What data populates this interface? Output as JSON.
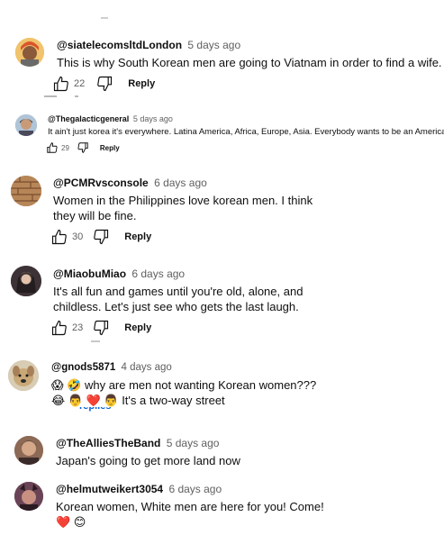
{
  "comments": [
    {
      "author": "@siatelecomsltdLondon",
      "time": "5 days ago",
      "text": "This is why South Korean men are going to Viatnam in order to find a wife.",
      "likes": "22",
      "reply": "Reply",
      "avatar_color": "#e8b65a"
    },
    {
      "author": "@Thegalacticgeneral",
      "time": "5 days ago",
      "text": "It ain't just korea it's everywhere. Latina America, Africa, Europe, Asia. Everybody wants to be an American.",
      "likes": "29",
      "reply": "Reply",
      "avatar_color": "#8a9bb0"
    },
    {
      "author": "@PCMRvsconsole",
      "time": "6 days ago",
      "text_line1": "Women in the Philippines love korean men. I think",
      "text_line2": "they will be fine.",
      "likes": "30",
      "reply": "Reply",
      "avatar_color": "#a87a52"
    },
    {
      "author": "@MiaobuMiao",
      "time": "6 days ago",
      "text_line1": "It's all fun and games until you're old, alone, and",
      "text_line2": "childless. Let's just see who gets the last laugh.",
      "likes": "23",
      "reply": "Reply",
      "avatar_color": "#4a3e44"
    },
    {
      "author": "@gnods5871",
      "time": "4 days ago",
      "text_line1": "😱 🤣 why are men not wanting Korean women???",
      "text_line2": "😂 👨 ❤️ 👨 It's a two-way street",
      "avatar_color": "#c9b9a0"
    },
    {
      "author": "@TheAlliesTheBand",
      "time": "5 days ago",
      "text": "Japan's going to get more land now",
      "avatar_color": "#9a7562"
    },
    {
      "author": "@helmutweikert3054",
      "time": "6 days ago",
      "text": "Korean women, White men are here for you!  Come!",
      "text_line2": "❤️ 😊",
      "avatar_color": "#5a3a4a"
    }
  ],
  "partial_link": "replies",
  "icons": {
    "like": "thumbs-up-icon",
    "dislike": "thumbs-down-icon"
  },
  "colors": {
    "link": "#065fd4",
    "secondary": "#606060"
  }
}
